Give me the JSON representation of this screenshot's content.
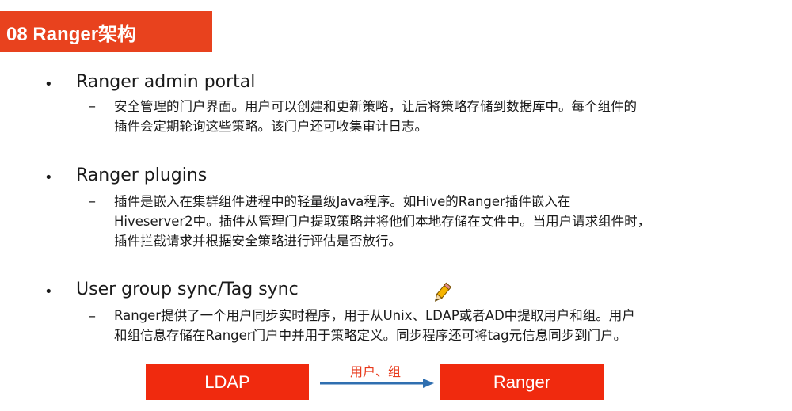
{
  "slide": {
    "title": "08 Ranger架构"
  },
  "sections": [
    {
      "bullet": "•",
      "heading": "Ranger admin portal",
      "dash": "–",
      "lines": [
        "安全管理的门户界面。用户可以创建和更新策略，让后将策略存储到数据库中。每个组件的",
        "插件会定期轮询这些策略。该门户还可收集审计日志。"
      ]
    },
    {
      "bullet": "•",
      "heading": "Ranger plugins",
      "dash": "–",
      "lines": [
        "插件是嵌入在集群组件进程中的轻量级Java程序。如Hive的Ranger插件嵌入在",
        "Hiveserver2中。插件从管理门户提取策略并将他们本地存储在文件中。当用户请求组件时，",
        "插件拦截请求并根据安全策略进行评估是否放行。"
      ]
    },
    {
      "bullet": "•",
      "heading": "User group sync/Tag sync",
      "dash": "–",
      "lines": [
        "Ranger提供了一个用户同步实时程序，用于从Unix、LDAP或者AD中提取用户和组。用户",
        "和组信息存储在Ranger门户中并用于策略定义。同步程序还可将tag元信息同步到门户。"
      ]
    }
  ],
  "diagram": {
    "left_box": "LDAP",
    "right_box": "Ranger",
    "arrow_label": "用户、组"
  },
  "icons": {
    "pencil": "pencil-icon",
    "arrow": "arrow-right-icon"
  },
  "colors": {
    "title_bg": "#e8421e",
    "box_bg": "#f02a0e",
    "arrow": "#2f6fb0",
    "arrow_label": "#e83a1c"
  }
}
